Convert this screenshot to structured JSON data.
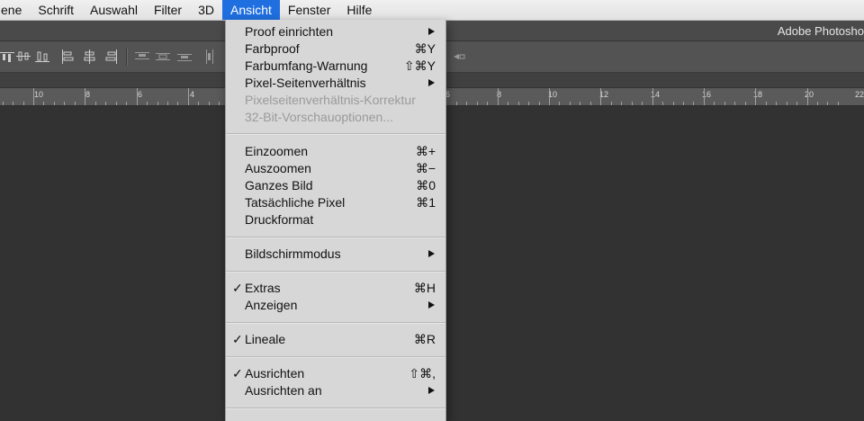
{
  "menubar": {
    "items": [
      {
        "label": "ene"
      },
      {
        "label": "Schrift"
      },
      {
        "label": "Auswahl"
      },
      {
        "label": "Filter"
      },
      {
        "label": "3D"
      },
      {
        "label": "Ansicht",
        "active": true
      },
      {
        "label": "Fenster"
      },
      {
        "label": "Hilfe"
      }
    ]
  },
  "titlebar": {
    "app_title": "Adobe Photosho"
  },
  "ruler": {
    "labels": [
      "10",
      "8",
      "6",
      "4",
      "6",
      "8",
      "10",
      "12",
      "14",
      "16",
      "18",
      "20",
      "22"
    ]
  },
  "colors": {
    "accent": "#1f6fe0",
    "menu_bg": "#d7d7d7",
    "workspace": "#323232"
  },
  "dropdown": {
    "items": [
      {
        "label": "Proof einrichten",
        "submenu": true
      },
      {
        "label": "Farbproof",
        "shortcut": "⌘Y"
      },
      {
        "label": "Farbumfang-Warnung",
        "shortcut": "⇧⌘Y"
      },
      {
        "label": "Pixel-Seitenverhältnis",
        "submenu": true
      },
      {
        "label": "Pixelseitenverhältnis-Korrektur",
        "disabled": true
      },
      {
        "label": "32-Bit-Vorschauoptionen...",
        "disabled": true
      },
      {
        "label": "Einzoomen",
        "shortcut": "⌘+"
      },
      {
        "label": "Auszoomen",
        "shortcut": "⌘−"
      },
      {
        "label": "Ganzes Bild",
        "shortcut": "⌘0"
      },
      {
        "label": "Tatsächliche Pixel",
        "shortcut": "⌘1"
      },
      {
        "label": "Druckformat"
      },
      {
        "label": "Bildschirmmodus",
        "submenu": true
      },
      {
        "label": "Extras",
        "shortcut": "⌘H",
        "checked": true
      },
      {
        "label": "Anzeigen",
        "submenu": true
      },
      {
        "label": "Lineale",
        "shortcut": "⌘R",
        "checked": true
      },
      {
        "label": "Ausrichten",
        "shortcut": "⇧⌘,",
        "checked": true
      },
      {
        "label": "Ausrichten an",
        "submenu": true
      }
    ],
    "check_glyph": "✓"
  }
}
